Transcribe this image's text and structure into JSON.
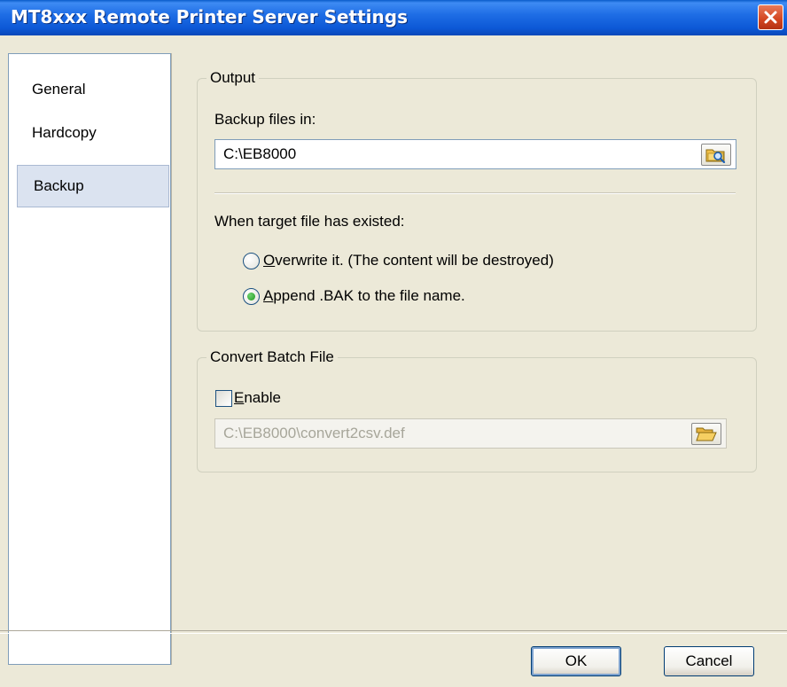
{
  "window": {
    "title": "MT8xxx Remote Printer Server Settings"
  },
  "sidebar": {
    "items": [
      {
        "label": "General",
        "selected": false
      },
      {
        "label": "Hardcopy",
        "selected": false
      },
      {
        "label": "Backup",
        "selected": true
      }
    ]
  },
  "output": {
    "legend": "Output",
    "backup_label": "Backup files in:",
    "backup_path": "C:\\EB8000",
    "exists_label": "When target file has existed:",
    "options": [
      {
        "mnemonic": "O",
        "rest": "verwrite it. (The content will be destroyed)",
        "selected": false
      },
      {
        "mnemonic": "A",
        "rest": "ppend .BAK to the file name.",
        "selected": true
      }
    ]
  },
  "convert": {
    "legend": "Convert Batch File",
    "enable_mnemonic": "E",
    "enable_rest": "nable",
    "enabled": false,
    "path": "C:\\EB8000\\convert2csv.def"
  },
  "footer": {
    "ok_label": "OK",
    "cancel_label": "Cancel"
  },
  "icons": [
    "close-icon",
    "browse-folder-icon",
    "open-folder-icon"
  ],
  "colors": {
    "titlebar": "#0c58d6",
    "selection": "#dbe3f0",
    "radio_dot": "#1f9a1f"
  }
}
